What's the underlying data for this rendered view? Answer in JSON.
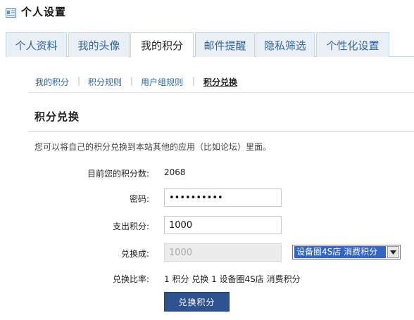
{
  "header": {
    "title": "个人设置",
    "icon": "settings-card-icon"
  },
  "tabs": [
    {
      "label": "个人资料",
      "active": false
    },
    {
      "label": "我的头像",
      "active": false
    },
    {
      "label": "我的积分",
      "active": true
    },
    {
      "label": "邮件提醒",
      "active": false
    },
    {
      "label": "隐私筛选",
      "active": false
    },
    {
      "label": "个性化设置",
      "active": false
    }
  ],
  "subnav": {
    "items": [
      "我的积分",
      "积分规则",
      "用户组规则",
      "积分兑换"
    ],
    "separator": "|",
    "active_index": 3
  },
  "section": {
    "title": "积分兑换",
    "description": "您可以将自己的积分兑换到本站其他的应用（比如论坛）里面。"
  },
  "form": {
    "current_points_label": "目前您的积分数:",
    "current_points_value": "2068",
    "password_label": "密码:",
    "password_value": "••••••••••",
    "spend_label": "支出积分:",
    "spend_value": "1000",
    "exchange_to_label": "兑换成:",
    "exchange_to_value": "1000",
    "target_select": "设备圈4S店 消费积分",
    "ratio_label": "兑换比率:",
    "ratio_value": "1 积分 兑换 1 设备圈4S店 消费积分",
    "submit_label": "兑换积分"
  },
  "colors": {
    "link": "#336699",
    "tab_bg": "#e8eff5",
    "tab_border": "#c2d5e3",
    "button_bg": "#2f5291",
    "select_highlight": "#3166c4"
  }
}
